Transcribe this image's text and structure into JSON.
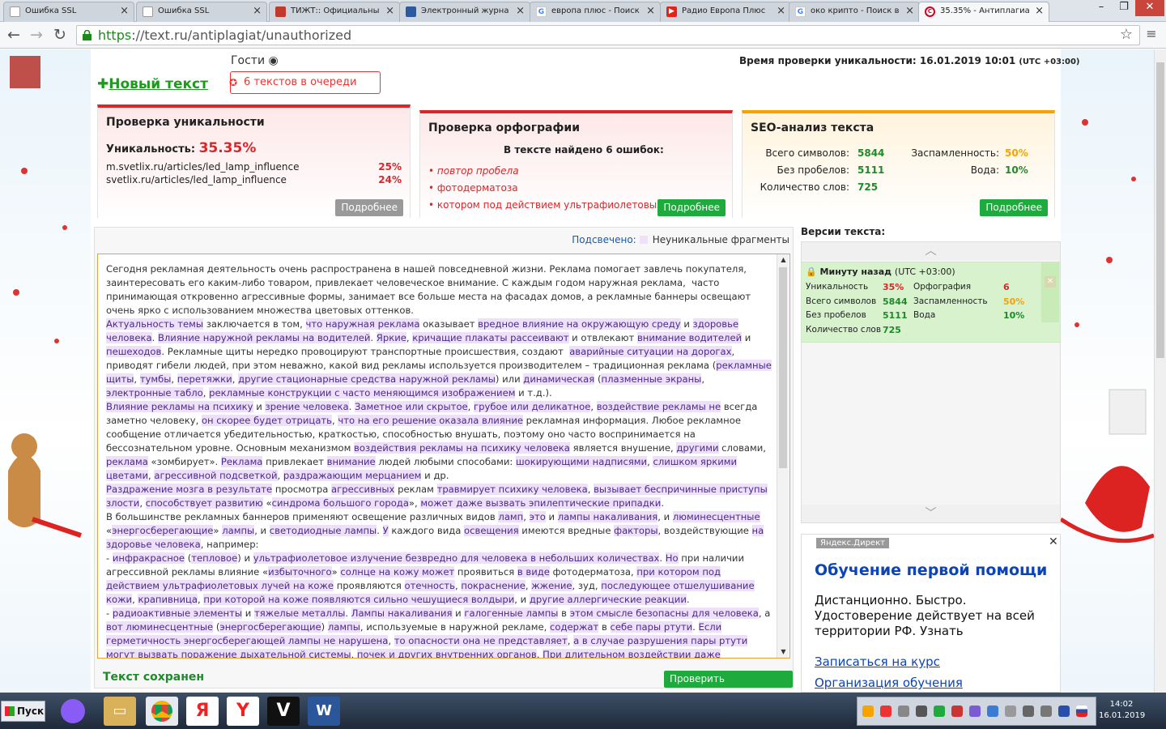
{
  "browser": {
    "tabs": [
      {
        "title": "Ошибка SSL",
        "fav_color": "#ffffff"
      },
      {
        "title": "Ошибка SSL",
        "fav_color": "#ffffff"
      },
      {
        "title": "ТИЖТ:: Официальны",
        "fav_color": "#c0392b"
      },
      {
        "title": "Электронный журна",
        "fav_color": "#2c5aa0"
      },
      {
        "title": "европа плюс - Поиск",
        "fav_color": "#4285f4"
      },
      {
        "title": "Радио Европа Плюс",
        "fav_color": "#e62117"
      },
      {
        "title": "око крипто - Поиск в",
        "fav_color": "#4285f4"
      },
      {
        "title": "35.35% - Антиплагиа",
        "fav_color": "#d0021b"
      }
    ],
    "url_scheme": "https",
    "url_rest": "://text.ru/antiplagiat/unauthorized"
  },
  "header": {
    "guests": "Гости",
    "new_text": "Новый текст",
    "queue": "6 текстов в очереди",
    "check_time_label": "Время проверки уникальности: 16.01.2019 10:01",
    "check_time_tz": "(UTC +03:00)"
  },
  "uniq_panel": {
    "title": "Проверка уникальности",
    "uniq_label": "Уникальность:",
    "uniq_value": "35.35%",
    "sources": [
      {
        "url": "m.svetlix.ru/articles/led_lamp_influence",
        "pct": "25%"
      },
      {
        "url": "svetlix.ru/articles/led_lamp_influence",
        "pct": "24%"
      }
    ],
    "more": "Подробнее"
  },
  "spell_panel": {
    "title": "Проверка орфографии",
    "summary": "В тексте найдено 6 ошибок:",
    "errors": [
      "повтор пробела",
      "фотодерматоза",
      "котором под действием ультрафиолетовых лучей"
    ],
    "more": "Подробнее"
  },
  "seo_panel": {
    "title": "SEO-анализ текста",
    "labels": {
      "chars": "Всего символов:",
      "nospace": "Без пробелов:",
      "words": "Количество слов:",
      "spam": "Заспамленность:",
      "water": "Вода:"
    },
    "values": {
      "chars": "5844",
      "nospace": "5111",
      "words": "725",
      "spam": "50%",
      "water": "10%"
    },
    "more": "Подробнее"
  },
  "text_area": {
    "legend_label": "Подсвечено:",
    "legend_text": "Неуникальные фрагменты",
    "saved": "Текст сохранен",
    "check_button": "Проверить уникальность"
  },
  "versions": {
    "title": "Версии текста:",
    "card_time": "Минуту назад",
    "card_tz": "(UTC +03:00)",
    "labels": {
      "uniq": "Уникальность",
      "spell": "Орфография",
      "chars": "Всего символов",
      "spam": "Заспамленность",
      "nospace": "Без пробелов",
      "water": "Вода",
      "words": "Количество слов"
    },
    "values": {
      "uniq": "35%",
      "spell": "6",
      "chars": "5844",
      "spam": "50%",
      "nospace": "5111",
      "water": "10%",
      "words": "725"
    }
  },
  "ad": {
    "tag": "Яндекс.Директ",
    "title": "Обучение первой помощи",
    "text": "Дистанционно. Быстро. Удостоверение действует на всей территории РФ. Узнать",
    "link1": "Записаться на курс",
    "link2": "Организация обучения"
  },
  "taskbar": {
    "start": "Пуск",
    "time": "14:02",
    "date": "16.01.2019"
  },
  "colors": {
    "accent_red": "#d9262a",
    "accent_green": "#1eaa3c",
    "accent_orange": "#f4a300",
    "highlight": "#eee0f8"
  }
}
